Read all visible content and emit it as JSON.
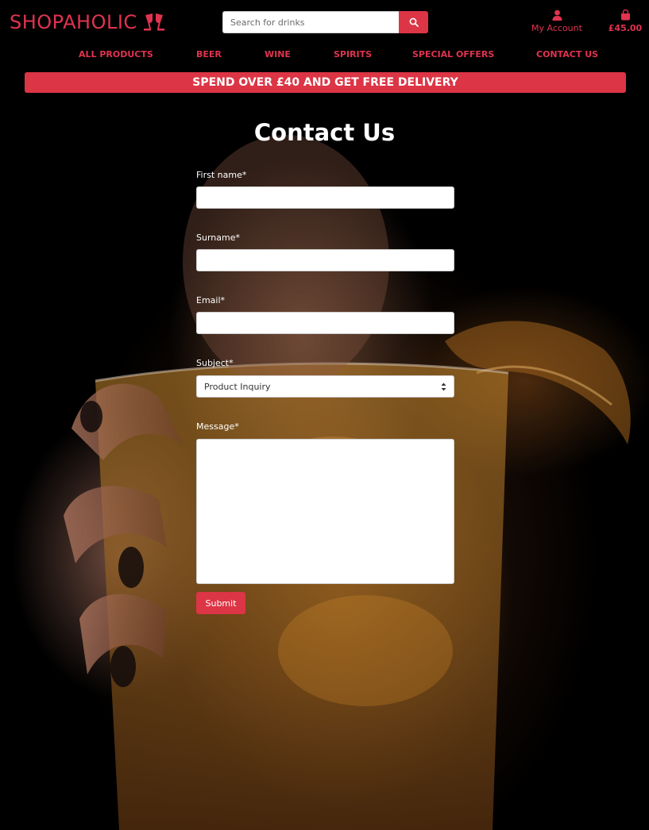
{
  "brand": {
    "name": "SHOPAHOLIC",
    "accent_color": "#e0334f",
    "logo_icon": "toasting-glasses-icon"
  },
  "search": {
    "placeholder": "Search for drinks",
    "button_icon": "search-icon"
  },
  "account": {
    "label": "My Account",
    "icon": "user-icon"
  },
  "cart": {
    "total": "£45.00",
    "icon": "shopping-bag-icon"
  },
  "nav": {
    "items": [
      {
        "label": "ALL PRODUCTS"
      },
      {
        "label": "BEER"
      },
      {
        "label": "WINE"
      },
      {
        "label": "SPIRITS"
      },
      {
        "label": "SPECIAL OFFERS"
      },
      {
        "label": "CONTACT US"
      }
    ]
  },
  "promo": {
    "text": "SPEND OVER £40 AND GET FREE DELIVERY",
    "color": "#dc3545"
  },
  "page": {
    "title": "Contact Us"
  },
  "form": {
    "first_name": {
      "label": "First name*",
      "value": ""
    },
    "surname": {
      "label": "Surname*",
      "value": ""
    },
    "email": {
      "label": "Email*",
      "value": ""
    },
    "subject": {
      "label": "Subject*",
      "selected": "Product Inquiry"
    },
    "message": {
      "label": "Message*",
      "value": ""
    },
    "submit_label": "Submit"
  }
}
